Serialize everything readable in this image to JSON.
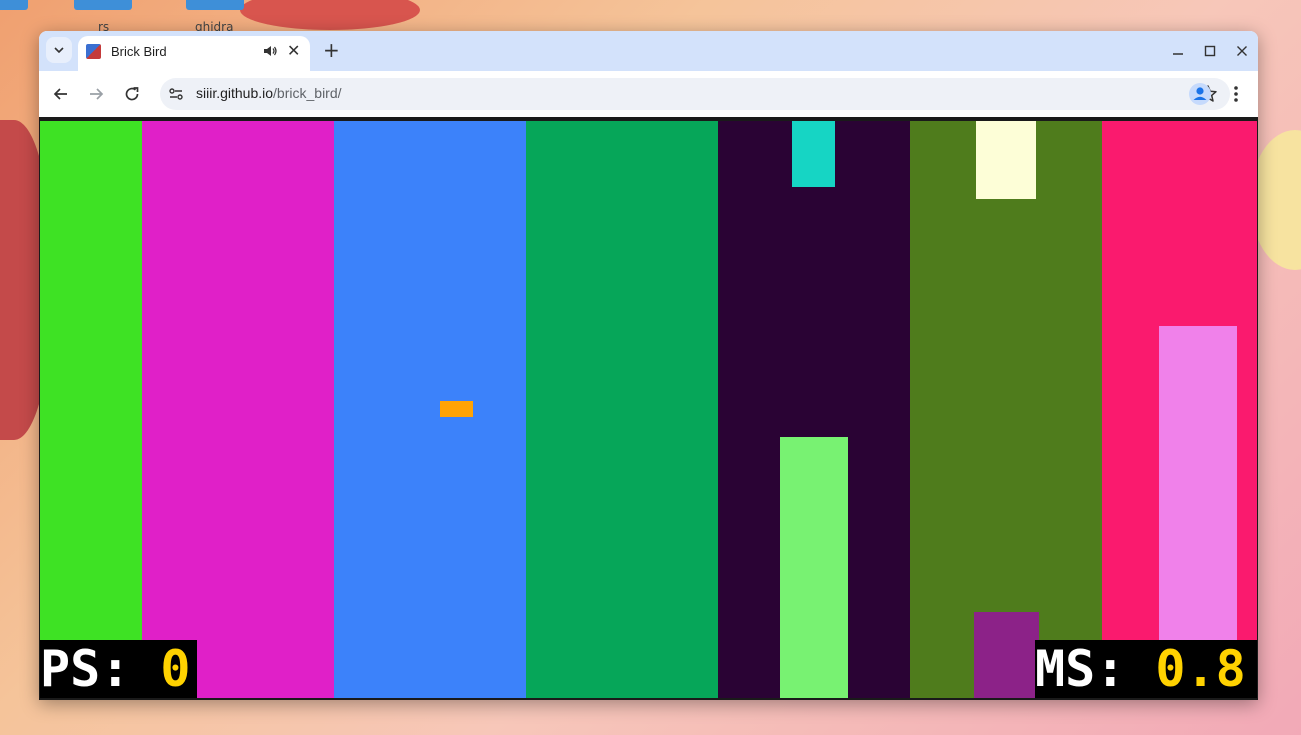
{
  "browser": {
    "tab_title": "Brick Bird",
    "url_host": "siiir.github.io",
    "url_path": "/brick_bird/"
  },
  "desktop": {
    "icon_labels": [
      "rs",
      "ghidra"
    ]
  },
  "game": {
    "stripes": [
      "#3ee224",
      "#e020c8",
      "#3c82fa",
      "#06a659",
      "#2a0334",
      "#4f7c1c",
      "#fa1a6e"
    ],
    "bricks": [
      {
        "name": "top-brick-teal",
        "color": "#16d5c4"
      },
      {
        "name": "bottom-brick-light-green",
        "color": "#78f272"
      },
      {
        "name": "top-brick-cream",
        "color": "#fdfed7"
      },
      {
        "name": "bottom-brick-purple",
        "color": "#8c2288"
      },
      {
        "name": "bottom-brick-pink",
        "color": "#f081ea"
      }
    ],
    "bird_color": "#ffa305",
    "hud_left": {
      "label": "PS: ",
      "value": "0"
    },
    "hud_right": {
      "label": "MS: ",
      "value": "0.8"
    }
  }
}
